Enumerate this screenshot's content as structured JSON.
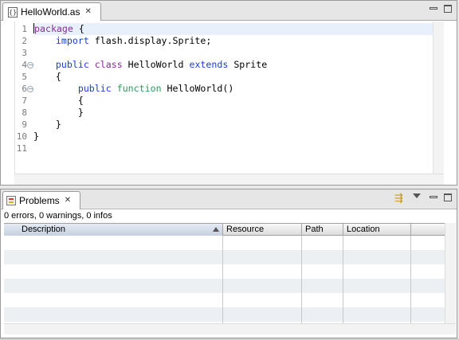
{
  "editor": {
    "tab_title": "HelloWorld.as",
    "file_icon": "actionscript-file-icon",
    "close_glyph": "✕",
    "lines": [
      {
        "num": "1",
        "tokens": [
          {
            "t": "package",
            "c": "kw-purple"
          },
          {
            "t": " {",
            "c": ""
          }
        ],
        "highlight": true,
        "caret": true
      },
      {
        "num": "2",
        "tokens": [
          {
            "t": "    ",
            "c": ""
          },
          {
            "t": "import",
            "c": "kw-blue"
          },
          {
            "t": " flash.display.Sprite;",
            "c": ""
          }
        ]
      },
      {
        "num": "3",
        "tokens": []
      },
      {
        "num": "4",
        "fold": true,
        "tokens": [
          {
            "t": "    ",
            "c": ""
          },
          {
            "t": "public",
            "c": "kw-blue"
          },
          {
            "t": " ",
            "c": ""
          },
          {
            "t": "class",
            "c": "kw-purple"
          },
          {
            "t": " HelloWorld ",
            "c": ""
          },
          {
            "t": "extends",
            "c": "kw-blue"
          },
          {
            "t": " Sprite",
            "c": ""
          }
        ]
      },
      {
        "num": "5",
        "tokens": [
          {
            "t": "    {",
            "c": ""
          }
        ]
      },
      {
        "num": "6",
        "fold": true,
        "tokens": [
          {
            "t": "        ",
            "c": ""
          },
          {
            "t": "public",
            "c": "kw-blue"
          },
          {
            "t": " ",
            "c": ""
          },
          {
            "t": "function",
            "c": "kw-green"
          },
          {
            "t": " HelloWorld()",
            "c": ""
          }
        ]
      },
      {
        "num": "7",
        "tokens": [
          {
            "t": "        {",
            "c": ""
          }
        ]
      },
      {
        "num": "8",
        "tokens": [
          {
            "t": "        }",
            "c": ""
          }
        ]
      },
      {
        "num": "9",
        "tokens": [
          {
            "t": "    }",
            "c": ""
          }
        ]
      },
      {
        "num": "10",
        "tokens": [
          {
            "t": "}",
            "c": ""
          }
        ]
      },
      {
        "num": "11",
        "tokens": []
      }
    ]
  },
  "problems": {
    "tab_title": "Problems",
    "close_glyph": "✕",
    "summary": "0 errors, 0 warnings, 0 infos",
    "columns": {
      "description": "Description",
      "resource": "Resource",
      "path": "Path",
      "location": "Location"
    },
    "sort_column": "description",
    "sort_direction": "ascending",
    "filter_glyph": "⇶"
  },
  "colors": {
    "keyword_blue": "#1b3dd6",
    "keyword_purple": "#8a2aa0",
    "keyword_green": "#2c9b5c",
    "current_line": "#e8f0fb",
    "row_stripe": "#edf0f3"
  }
}
